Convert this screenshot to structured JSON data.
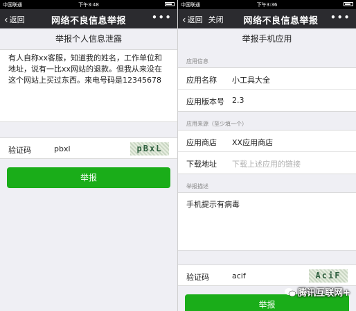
{
  "left": {
    "status": {
      "carrier": "中国联通",
      "time": "下午3:48",
      "battery": "●"
    },
    "nav": {
      "back_label": "返回",
      "title": "网络不良信息举报",
      "more": "•••"
    },
    "heading": "举报个人信息泄露",
    "report_text": "有人自称xx客服，知道我的姓名，工作单位和地址，说有一比xx网站的退款。但我从来没在这个网站上买过东西。来电号码是12345678",
    "captcha": {
      "label": "验证码",
      "value": "pbxl",
      "image_text": "pBxL"
    },
    "submit_label": "举报"
  },
  "right": {
    "status": {
      "carrier": "中国联通",
      "time": "下午3:36",
      "battery": "●"
    },
    "nav": {
      "back_label": "返回",
      "close_label": "关闭",
      "title": "网络不良信息举报",
      "more": "•••"
    },
    "heading": "举报手机应用",
    "app_info": {
      "section": "应用信息",
      "name_label": "应用名称",
      "name_value": "小工具大全",
      "version_label": "应用版本号",
      "version_value": "2.3"
    },
    "app_source": {
      "section": "应用来源（至少填一个）",
      "store_label": "应用商店",
      "store_value": "XX应用商店",
      "download_label": "下载地址",
      "download_placeholder": "下载上述应用的链接"
    },
    "description": {
      "section": "举报描述",
      "text": "手机提示有病毒"
    },
    "captcha": {
      "label": "验证码",
      "value": "acif",
      "image_text": "AciF"
    },
    "submit_label": "举报"
  },
  "watermark": "腾讯互联网+"
}
